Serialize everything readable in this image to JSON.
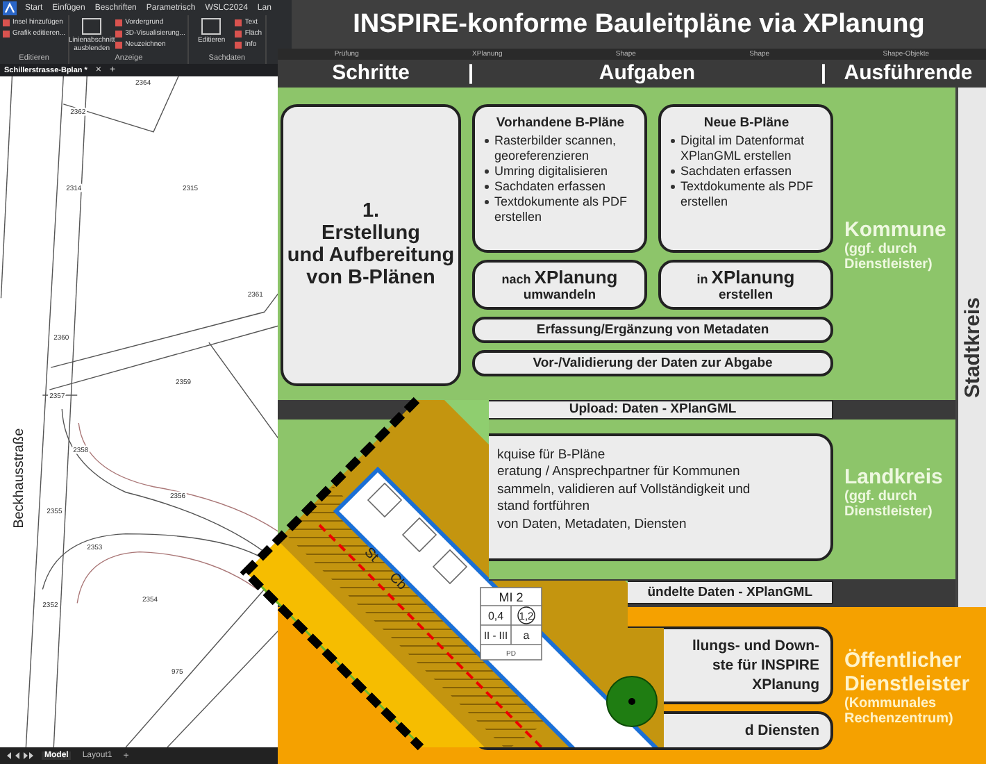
{
  "cad": {
    "app_tabs": [
      {
        "label": "Start",
        "selected": false
      },
      {
        "label": "Einfügen",
        "selected": false
      },
      {
        "label": "Beschriften",
        "selected": false
      },
      {
        "label": "Parametrisch",
        "selected": false
      },
      {
        "label": "WSLC2024",
        "selected": false
      },
      {
        "label": "Lan",
        "selected": false
      }
    ],
    "ribbon_groups": [
      {
        "label": "Editieren",
        "items": [
          {
            "kind": "small",
            "label": "Insel hinzufügen"
          },
          {
            "kind": "small",
            "label": "Grafik editieren..."
          }
        ]
      },
      {
        "label": "Anzeige",
        "items": [
          {
            "kind": "large",
            "label": "Linienabschnitt ausblenden"
          },
          {
            "kind": "small",
            "label": "Vordergrund"
          },
          {
            "kind": "small",
            "label": "3D-Visualisierung..."
          },
          {
            "kind": "small",
            "label": "Neuzeichnen"
          }
        ]
      },
      {
        "label": "Sachdaten",
        "items": [
          {
            "kind": "large",
            "label": "Editieren"
          },
          {
            "kind": "small",
            "label": "Text"
          },
          {
            "kind": "small",
            "label": "Fläch"
          },
          {
            "kind": "small",
            "label": "Info"
          }
        ]
      }
    ],
    "document_tab": "Schillerstrasse-Bplan *",
    "document_close": "×",
    "document_add": "+",
    "map": {
      "street": "Beckhausstraße",
      "parcels": [
        "2364",
        "2362",
        "2314",
        "2315",
        "2361",
        "2360",
        "2359",
        "2357",
        "2358",
        "2356",
        "2355",
        "2353",
        "2354",
        "2352",
        "975"
      ]
    },
    "layout_tabs": [
      {
        "label": "Model",
        "selected": true
      },
      {
        "label": "Layout1",
        "selected": false
      }
    ],
    "layout_add": "+"
  },
  "poster": {
    "title": "INSPIRE-konforme Bauleitpläne via XPlanung",
    "ribbon_labels": [
      "Prüfung",
      "XPlanung",
      "Shape",
      "Shape",
      "Shape-Objekte"
    ],
    "headers": [
      "Schritte",
      "|",
      "Aufgaben",
      "|",
      "Ausführende"
    ],
    "side_label": "Stadtkreis",
    "step_band": {
      "step": "1.\nErstellung\nund Aufbereitung\nvon B-Plänen",
      "cards": [
        {
          "title": "Vorhandene B-Pläne",
          "bullets": [
            "Rasterbilder scannen, georeferenzieren",
            "Umring digitalisieren",
            "Sachdaten erfassen",
            "Textdokumente als PDF erstellen"
          ]
        },
        {
          "title": "Neue B-Pläne",
          "bullets": [
            "Digital im Datenformat XPlanGML erstellen",
            "Sachdaten erfassen",
            "Textdokumente als PDF erstellen"
          ]
        }
      ],
      "conversions": [
        {
          "prefix": "nach",
          "main": "XPlanung",
          "sub": "umwandeln"
        },
        {
          "prefix": "in",
          "main": "XPlanung",
          "sub": "erstellen"
        }
      ],
      "bars": [
        "Erfassung/Ergänzung von Metadaten",
        "Vor-/Validierung der Daten zur Abgabe"
      ],
      "executor": {
        "name": "Kommune",
        "note": "(ggf. durch Dienstleister)"
      }
    },
    "upload_row": "Upload: Daten - XPlanGML",
    "district_band": {
      "lines": [
        "kquise für B-Pläne",
        "eratung / Ansprechpartner für Kommunen",
        "sammeln, validieren auf Vollständigkeit und",
        "stand fortführen",
        "von Daten, Metadaten, Diensten"
      ],
      "executor": {
        "name": "Landkreis",
        "note": "(ggf. durch Dienstleister)"
      }
    },
    "bundle_row": "ündelte Daten - XPlanGML",
    "provider_band": {
      "boxes": [
        [
          "llungs- und Down-",
          "ste für INSPIRE",
          "XPlanung"
        ],
        [
          "d Diensten"
        ]
      ],
      "executor": {
        "name": "Öffentlicher Dienstleister",
        "note": "(Kommunales Rechenzentrum)"
      }
    }
  },
  "plan": {
    "zone": "MI 2",
    "cells": [
      "0,4",
      "1,2",
      "II - III",
      "a"
    ],
    "footer": "PD",
    "hatch_labels": [
      "St",
      "Cb"
    ]
  }
}
